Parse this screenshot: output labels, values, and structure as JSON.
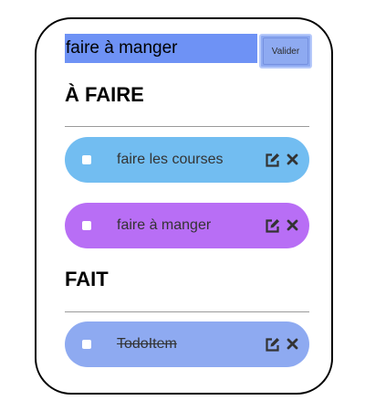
{
  "new_task": {
    "value": "faire à manger",
    "submit_label": "Valider"
  },
  "todo": {
    "title": "À FAIRE",
    "items": [
      {
        "label": "faire les courses",
        "color": "#72bdf1",
        "checked": false
      },
      {
        "label": "faire à manger",
        "color": "#b86ef5",
        "checked": false
      }
    ]
  },
  "done": {
    "title": "FAIT",
    "items": [
      {
        "label": "TodoItem",
        "color": "#8eaaf1",
        "checked": false
      }
    ]
  },
  "icons": {
    "edit": "edit-icon",
    "delete": "close-icon"
  }
}
